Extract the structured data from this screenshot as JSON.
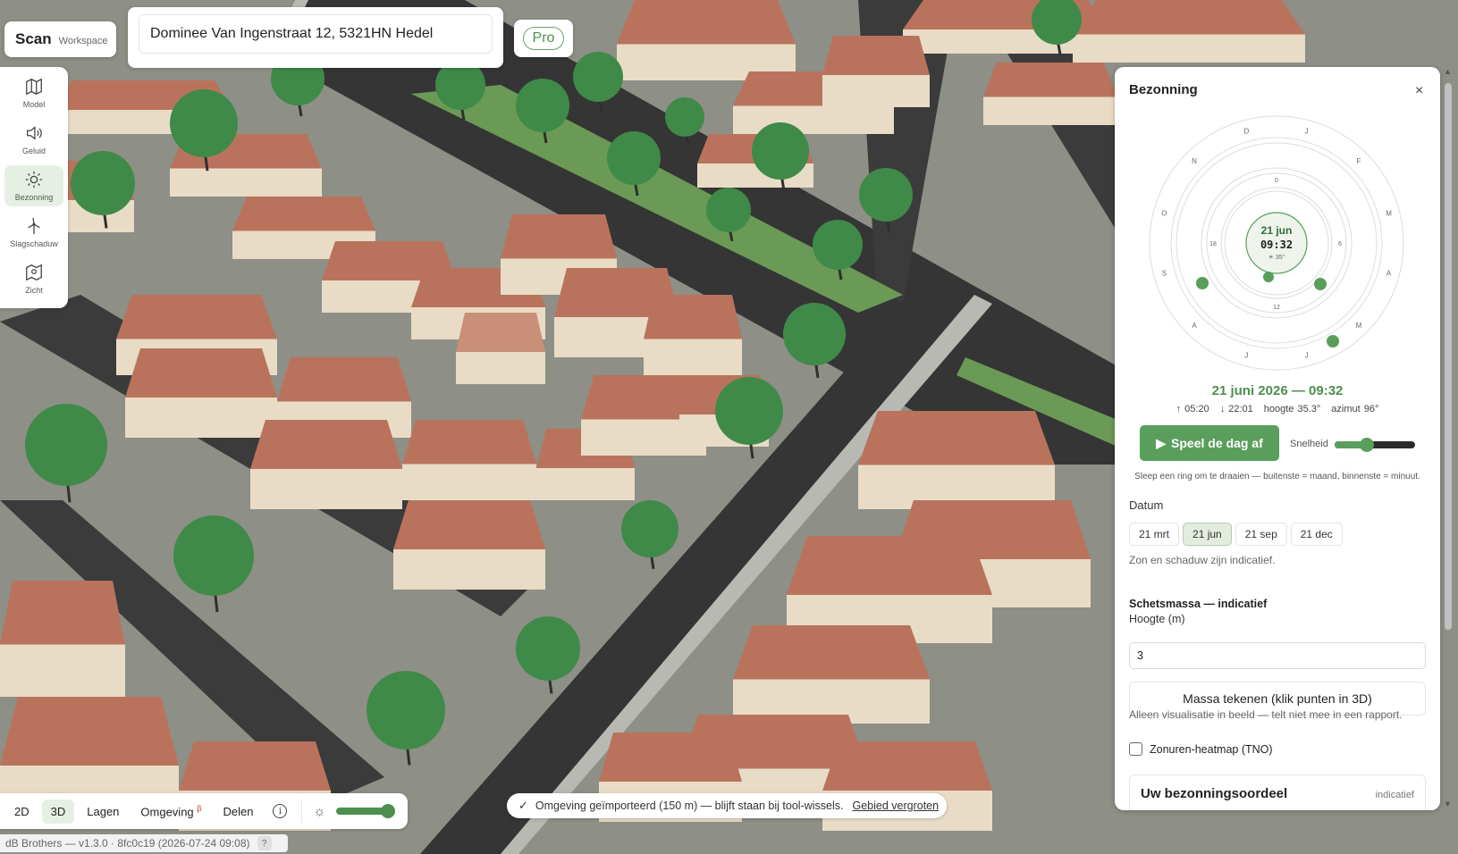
{
  "brand": {
    "name": "Scan",
    "subtitle": "Workspace"
  },
  "address": {
    "value": "Dominee Van Ingenstraat 12, 5321HN Hedel"
  },
  "pro_label": "Pro",
  "sidebar": {
    "items": [
      {
        "label": "Model",
        "icon": "map-icon"
      },
      {
        "label": "Geluid",
        "icon": "speaker-icon"
      },
      {
        "label": "Bezonning",
        "icon": "sun-icon",
        "active": true
      },
      {
        "label": "Slagschaduw",
        "icon": "wind-turbine-icon"
      },
      {
        "label": "Zicht",
        "icon": "view-map-icon"
      }
    ]
  },
  "bottombar": {
    "btn_2d": "2D",
    "btn_3d": "3D",
    "lagen": "Lagen",
    "omgeving": "Omgeving",
    "omgeving_badge": "β",
    "delen": "Delen",
    "brightness_level": 1.0
  },
  "version": {
    "text": "dB Brothers — v1.3.0 · 8fc0c19 (2026-07-24 09:08)",
    "help": "?"
  },
  "toast": {
    "check": "✓",
    "message": "Omgeving geïmporteerd (150 m) — blijft staan bij tool-wissels.",
    "link": "Gebied vergroten"
  },
  "panel": {
    "title": "Bezonning",
    "close": "×",
    "dial": {
      "center_date": "21 jun",
      "center_time": "09:32",
      "center_alt": "☀ 35°",
      "month_letters": [
        "J",
        "F",
        "M",
        "A",
        "M",
        "J",
        "J",
        "A",
        "S",
        "O",
        "N",
        "D"
      ],
      "hour_marks": [
        "0",
        "6",
        "12",
        "18"
      ]
    },
    "date_big": "21 juni 2026 — 09:32",
    "sunrise": "↑ 05:20",
    "sunset": "↓ 22:01",
    "altitude": "hoogte 35.3°",
    "azimuth": "azimut 96°",
    "play_label": "Speel de dag af",
    "speed_label": "Snelheid",
    "speed_level": 0.4,
    "hint": "Sleep een ring om te draaien — buitenste = maand, binnenste = minuut.",
    "datum_label": "Datum",
    "date_chips": [
      {
        "label": "21 mrt"
      },
      {
        "label": "21 jun",
        "active": true
      },
      {
        "label": "21 sep"
      },
      {
        "label": "21 dec"
      }
    ],
    "indicative_note": "Zon en schaduw zijn indicatief.",
    "schetsmassa_title": "Schetsmassa — indicatief",
    "hoogte_label": "Hoogte (m)",
    "hoogte_value": "3",
    "draw_button": "Massa tekenen (klik punten in 3D)",
    "visual_note": "Alleen visualisatie in beeld — telt niet mee in een rapport.",
    "heatmap_label": "Zonuren-heatmap (TNO)",
    "card_title": "Uw bezonningsoordeel",
    "card_badge": "indicatief"
  },
  "colors": {
    "accent": "#5a9e5c",
    "roof": "#b9735c",
    "wall": "#e8dcc6",
    "road": "#3a3a3a",
    "tree": "#3f8a48"
  }
}
